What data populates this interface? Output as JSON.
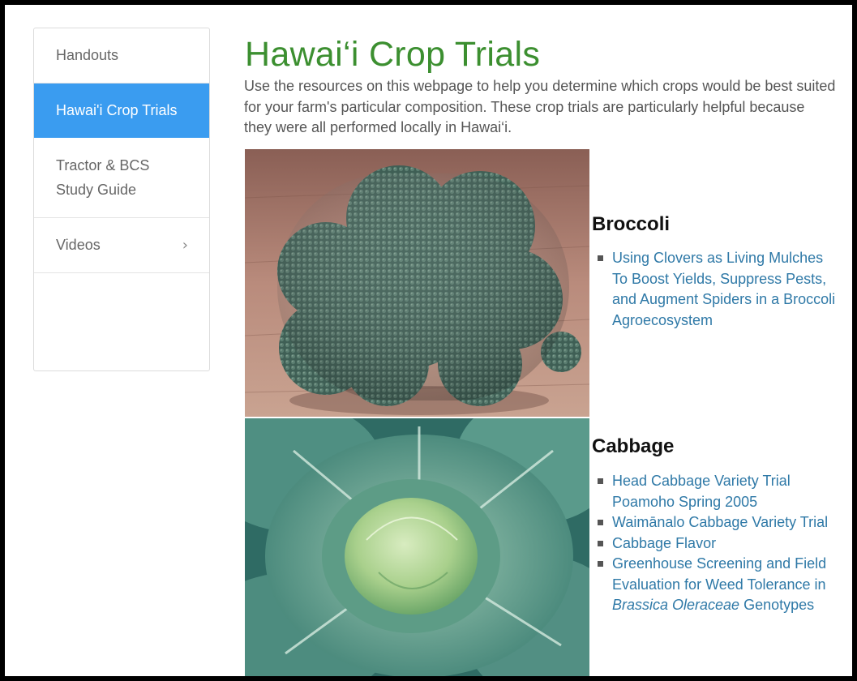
{
  "sidebar": {
    "items": [
      {
        "label": "Handouts"
      },
      {
        "label": "Hawai'i Crop Trials",
        "active": true
      },
      {
        "label_line1": "Tractor & BCS",
        "label_line2": "Study Guide"
      },
      {
        "label": "Videos",
        "chevron": "›"
      }
    ]
  },
  "main": {
    "title": "Hawai‘i Crop Trials",
    "intro": "Use the resources on this webpage to help you determine which crops would be best suited for your farm's particular composition. These crop trials are particularly helpful because they were all performed locally in Hawai‘i."
  },
  "crops": [
    {
      "name": "Broccoli",
      "image": "broccoli-photo",
      "links": [
        "Using Clovers as Living Mulches To Boost Yields, Suppress Pests, and Augment Spiders in a Broccoli Agroecosystem"
      ]
    },
    {
      "name": "Cabbage",
      "image": "cabbage-photo",
      "links": [
        "Head Cabbage Variety Trial Poamoho Spring 2005",
        "Waimānalo Cabbage Variety Trial",
        "Cabbage Flavor"
      ],
      "last_link": {
        "pre": "Greenhouse Screening and Field Evaluation for Weed Tolerance in ",
        "italic": "Brassica Oleraceae",
        "post": " Genotypes"
      }
    }
  ],
  "colors": {
    "title_green": "#3c8f30",
    "sidebar_active": "#3a9cf0",
    "link_blue": "#2f79a7"
  }
}
